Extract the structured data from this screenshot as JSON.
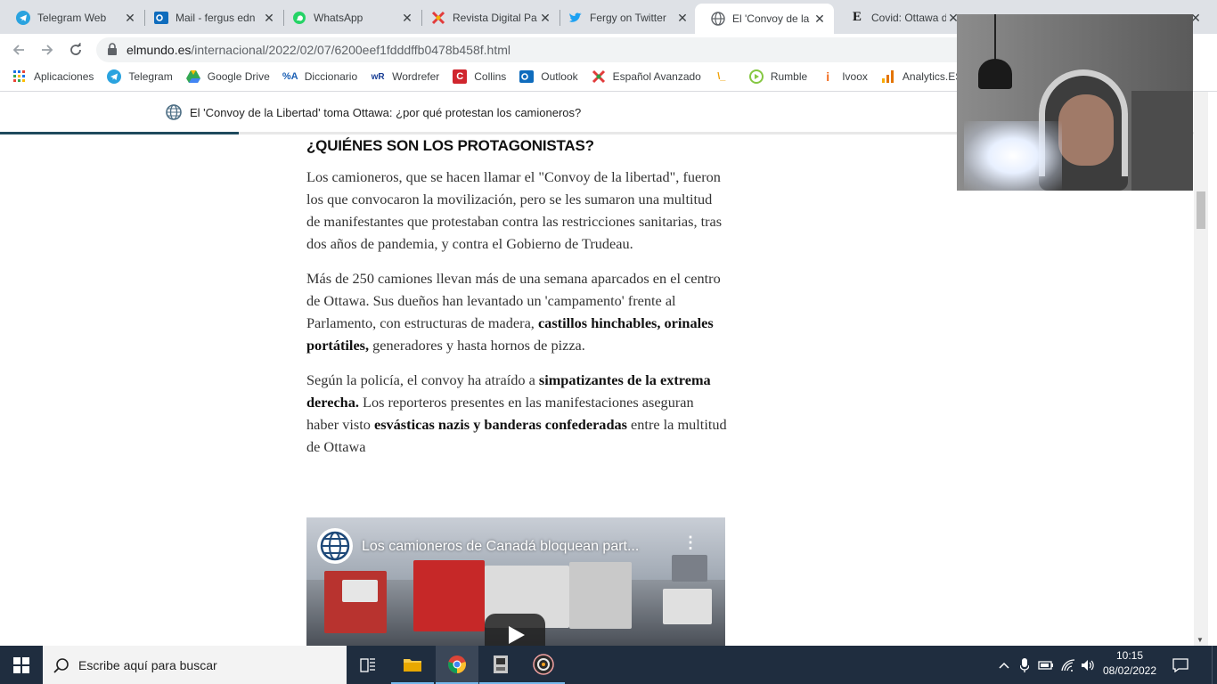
{
  "browser": {
    "tabs": [
      {
        "title": "Telegram Web",
        "icon": "telegram-icon",
        "color": "#2aa3df"
      },
      {
        "title": "Mail - fergus edn",
        "icon": "outlook-icon",
        "color": "#0f6cbd"
      },
      {
        "title": "WhatsApp",
        "icon": "whatsapp-icon",
        "color": "#25d366"
      },
      {
        "title": "Revista Digital Pa",
        "icon": "revista-icon",
        "color": "#e23b3b"
      },
      {
        "title": "Fergy on Twitter",
        "icon": "twitter-icon",
        "color": "#1da1f2"
      },
      {
        "title": "El 'Convoy de la",
        "icon": "globe-icon",
        "color": "#5f6368",
        "active": true
      },
      {
        "title": "Covid: Ottawa de",
        "icon": "elpais-icon",
        "color": "#111111"
      }
    ],
    "url_host": "elmundo.es",
    "url_path": "/internacional/2022/02/07/6200eef1fdddffb0478b458f.html",
    "bookmarks": [
      {
        "label": "Aplicaciones",
        "icon": "apps-grid-icon"
      },
      {
        "label": "Telegram",
        "icon": "telegram-icon"
      },
      {
        "label": "Google Drive",
        "icon": "drive-icon"
      },
      {
        "label": "Diccionario",
        "icon": "dictionary-icon"
      },
      {
        "label": "Wordrefer",
        "icon": "wordreference-icon"
      },
      {
        "label": "Collins",
        "icon": "collins-icon"
      },
      {
        "label": "Outlook",
        "icon": "outlook-icon"
      },
      {
        "label": "Español Avanzado",
        "icon": "espanol-icon"
      },
      {
        "label": "",
        "icon": "slash-icon"
      },
      {
        "label": "Rumble",
        "icon": "rumble-icon"
      },
      {
        "label": "Ivoox",
        "icon": "ivoox-icon"
      },
      {
        "label": "Analytics.ES",
        "icon": "analytics-icon"
      }
    ]
  },
  "page": {
    "sticky_title": "El 'Convoy de la Libertad' toma Ottawa: ¿por qué protestan los camioneros?",
    "reading_progress": 0.2,
    "heading": "¿QUIÉNES SON LOS PROTAGONISTAS?",
    "p1": "Los camioneros, que se hacen llamar el \"Convoy de la libertad\", fueron los que convocaron la movilización, pero se les sumaron una multitud de manifestantes que protestaban contra las restricciones sanitarias, tras dos años de pandemia, y contra el Gobierno de Trudeau.",
    "p2_a": "Más de 250 camiones llevan más de una semana aparcados en el centro de Ottawa. Sus dueños han levantado un 'campamento' frente al Parlamento, con estructuras de madera, ",
    "p2_b": "castillos hinchables, orinales portátiles,",
    "p2_c": " generadores y hasta hornos de pizza.",
    "p3_a": "Según la policía, el convoy ha atraído a ",
    "p3_b": "simpatizantes de la extrema derecha.",
    "p3_c": " Los reporteros presentes en las manifestaciones aseguran haber visto ",
    "p3_d": "esvásticas nazis y banderas confederadas",
    "p3_e": " entre la multitud de Ottawa",
    "video_title": "Los camioneros de Canadá bloquean part..."
  },
  "taskbar": {
    "search_placeholder": "Escribe aquí para buscar",
    "time": "10:15",
    "date": "08/02/2022"
  }
}
